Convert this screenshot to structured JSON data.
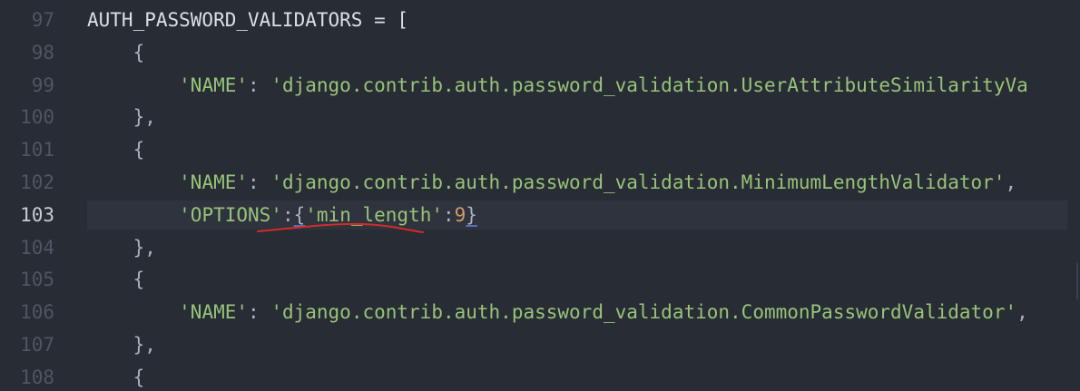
{
  "editor": {
    "lines": [
      {
        "number": "97",
        "tokens": [
          {
            "t": "AUTH_PASSWORD_VALIDATORS = [",
            "c": "id"
          }
        ]
      },
      {
        "number": "98",
        "tokens": [
          {
            "t": "    {",
            "c": "p"
          }
        ]
      },
      {
        "number": "99",
        "tokens": [
          {
            "t": "        ",
            "c": "p"
          },
          {
            "t": "'NAME'",
            "c": "s"
          },
          {
            "t": ": ",
            "c": "p"
          },
          {
            "t": "'django.contrib.auth.password_validation.UserAttributeSimilarityVa",
            "c": "s"
          }
        ]
      },
      {
        "number": "100",
        "tokens": [
          {
            "t": "    },",
            "c": "p"
          }
        ]
      },
      {
        "number": "101",
        "tokens": [
          {
            "t": "    {",
            "c": "p"
          }
        ]
      },
      {
        "number": "102",
        "tokens": [
          {
            "t": "        ",
            "c": "p"
          },
          {
            "t": "'NAME'",
            "c": "s"
          },
          {
            "t": ": ",
            "c": "p"
          },
          {
            "t": "'django.contrib.auth.password_validation.MinimumLengthValidator'",
            "c": "s"
          },
          {
            "t": ",",
            "c": "p"
          }
        ]
      },
      {
        "number": "103",
        "active": true,
        "tokens": [
          {
            "t": "        ",
            "c": "p"
          },
          {
            "t": "'OPTIONS'",
            "c": "s"
          },
          {
            "t": ":",
            "c": "p"
          },
          {
            "t": "{",
            "c": "p ul"
          },
          {
            "t": "'min_length'",
            "c": "s"
          },
          {
            "t": ":",
            "c": "p"
          },
          {
            "t": "9",
            "c": "n"
          },
          {
            "t": "}",
            "c": "p ul"
          }
        ]
      },
      {
        "number": "104",
        "tokens": [
          {
            "t": "    },",
            "c": "p"
          }
        ]
      },
      {
        "number": "105",
        "tokens": [
          {
            "t": "    {",
            "c": "p"
          }
        ]
      },
      {
        "number": "106",
        "tokens": [
          {
            "t": "        ",
            "c": "p"
          },
          {
            "t": "'NAME'",
            "c": "s"
          },
          {
            "t": ": ",
            "c": "p"
          },
          {
            "t": "'django.contrib.auth.password_validation.CommonPasswordValidator'",
            "c": "s"
          },
          {
            "t": ",",
            "c": "p"
          }
        ]
      },
      {
        "number": "107",
        "tokens": [
          {
            "t": "    },",
            "c": "p"
          }
        ]
      },
      {
        "number": "108",
        "tokens": [
          {
            "t": "    {",
            "c": "p"
          }
        ]
      }
    ]
  },
  "colors": {
    "background": "#282c34",
    "string": "#98c379",
    "number": "#d19a66",
    "annotation": "#e03b3b"
  }
}
